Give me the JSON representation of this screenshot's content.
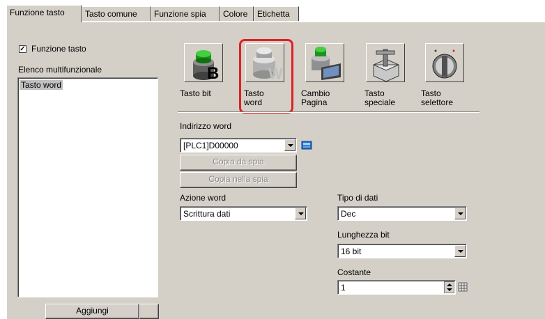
{
  "tabs": [
    {
      "label": "Funzione tasto",
      "active": true
    },
    {
      "label": "Tasto comune",
      "active": false
    },
    {
      "label": "Funzione spia",
      "active": false
    },
    {
      "label": "Colore",
      "active": false
    },
    {
      "label": "Etichetta",
      "active": false
    }
  ],
  "left": {
    "checkbox_label": "Funzione tasto",
    "checkbox_checked": true,
    "list_title": "Elenco multifunzionale",
    "list_items": [
      "Tasto word"
    ],
    "add_button": "Aggiungi"
  },
  "key_types": [
    {
      "line1": "Tasto bit",
      "line2": "",
      "icon": "bit-key-icon"
    },
    {
      "line1": "Tasto",
      "line2": "word",
      "icon": "word-key-icon",
      "selected": true
    },
    {
      "line1": "Cambio",
      "line2": "Pagina",
      "icon": "page-change-icon"
    },
    {
      "line1": "Tasto",
      "line2": "speciale",
      "icon": "special-key-icon"
    },
    {
      "line1": "Tasto",
      "line2": "selettore",
      "icon": "selector-key-icon"
    }
  ],
  "word_address": {
    "label": "Indirizzo word",
    "value": "[PLC1]D00000",
    "copy_from_lamp": "Copia da spia",
    "copy_to_lamp": "Copia nella spia"
  },
  "word_action": {
    "label": "Azione word",
    "value": "Scrittura dati"
  },
  "data_type": {
    "label": "Tipo di dati",
    "value": "Dec"
  },
  "bit_length": {
    "label": "Lunghezza bit",
    "value": "16 bit"
  },
  "constant": {
    "label": "Costante",
    "value": "1"
  },
  "colors": {
    "highlight": "#e02020",
    "panel": "#d4d0c8"
  }
}
